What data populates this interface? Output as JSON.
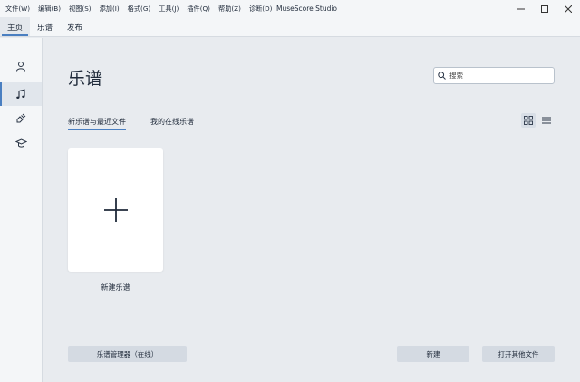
{
  "menu": {
    "items": [
      "文件(W)",
      "编辑(B)",
      "视图(S)",
      "添加(I)",
      "格式(G)",
      "工具(J)",
      "插件(Q)",
      "帮助(Z)",
      "诊断(D)"
    ],
    "app_title": "MuseScore Studio"
  },
  "top_tabs": [
    "主页",
    "乐谱",
    "发布"
  ],
  "main": {
    "title": "乐谱",
    "search_placeholder": "搜索",
    "sub_tabs": [
      "新乐谱与最近文件",
      "我的在线乐谱"
    ],
    "new_card_label": "新建乐谱",
    "buttons": {
      "score_manager": "乐谱管理器（在线）",
      "new": "新建",
      "open_other": "打开其他文件"
    }
  },
  "colors": {
    "accent": "#4a7fc1",
    "background": "#e8ebef",
    "panel": "#f4f6f8"
  }
}
